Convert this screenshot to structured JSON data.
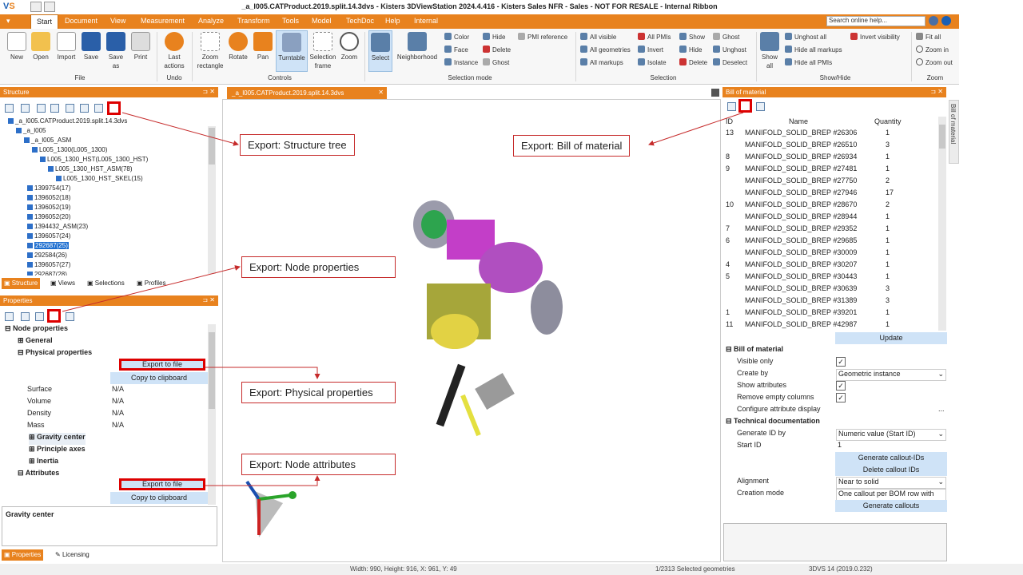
{
  "title": "_a_l005.CATProduct.2019.split.14.3dvs - Kisters 3DViewStation 2024.4.416 - Kisters Sales NFR - Sales - NOT FOR RESALE - Internal Ribbon",
  "menu": [
    "Start",
    "Document",
    "View",
    "Measurement",
    "Analyze",
    "Transform",
    "Tools",
    "Model",
    "TechDoc",
    "Help",
    "Internal"
  ],
  "search_placeholder": "Search online help...",
  "ribbon": {
    "file": [
      "New",
      "Open",
      "Import",
      "Save",
      "Save as",
      "Print"
    ],
    "file_group": "File",
    "undo": "Last actions",
    "undo_group": "Undo",
    "controls": [
      "Zoom rectangle",
      "Rotate",
      "Pan",
      "Turntable",
      "Selection frame",
      "Zoom"
    ],
    "controls_group": "Controls",
    "selmode_big": [
      "Select",
      "Neighborhood"
    ],
    "selmode_small": [
      "Color",
      "Face",
      "Instance",
      "Hide",
      "Delete",
      "Ghost",
      "PMI reference"
    ],
    "selmode_group": "Selection mode",
    "selection_small": [
      "All visible",
      "All geometries",
      "All markups",
      "All PMIs",
      "Invert",
      "Isolate",
      "Show",
      "Hide",
      "Delete",
      "Ghost",
      "Unghost",
      "Deselect"
    ],
    "selection_group": "Selection",
    "showhide_big": "Show all",
    "showhide_small": [
      "Unghost all",
      "Hide all markups",
      "Hide all PMIs",
      "Invert visibility"
    ],
    "showhide_group": "Show/Hide",
    "zoom_small": [
      "Fit all",
      "Zoom in",
      "Zoom out"
    ],
    "zoom_group": "Zoom"
  },
  "structure": {
    "header": "Structure",
    "rows": [
      "_a_l005.CATProduct.2019.split.14.3dvs",
      "_a_l005",
      "_a_l005_ASM",
      "L005_1300(L005_1300)",
      "L005_1300_HST(L005_1300_HST)",
      "L005_1300_HST_ASM(78)",
      "L005_1300_HST_SKEL(15)",
      "1399754(17)",
      "1396052(18)",
      "1396052(19)",
      "1396052(20)",
      "1394432_ASM(23)",
      "1396057(24)",
      "292687(25)",
      "292584(26)",
      "1396057(27)",
      "292687(28)"
    ],
    "tabs": [
      "Structure",
      "Views",
      "Selections",
      "Profiles"
    ]
  },
  "properties": {
    "header": "Properties",
    "node": "Node properties",
    "general": "General",
    "physical": "Physical properties",
    "export": "Export to file",
    "copy": "Copy to clipboard",
    "fields": [
      [
        "Surface",
        "N/A"
      ],
      [
        "Volume",
        "N/A"
      ],
      [
        "Density",
        "N/A"
      ],
      [
        "Mass",
        "N/A"
      ]
    ],
    "sub": [
      "Gravity center",
      "Principle axes",
      "Inertia"
    ],
    "attributes": "Attributes",
    "desc_title": "Gravity center",
    "tabs": [
      "Properties",
      "Licensing"
    ]
  },
  "callouts": {
    "structure": "Export: Structure tree",
    "bom": "Export: Bill of material",
    "node_props": "Export: Node properties",
    "phys": "Export: Physical properties",
    "attrs": "Export: Node attributes"
  },
  "doc_tab": "_a_l005.CATProduct.2019.split.14.3dvs",
  "bom": {
    "header": "Bill of material",
    "cols": [
      "ID",
      "Name",
      "Quantity"
    ],
    "rows": [
      [
        "13",
        "MANIFOLD_SOLID_BREP #26306",
        "1"
      ],
      [
        "",
        "MANIFOLD_SOLID_BREP #26510",
        "3"
      ],
      [
        "8",
        "MANIFOLD_SOLID_BREP #26934",
        "1"
      ],
      [
        "9",
        "MANIFOLD_SOLID_BREP #27481",
        "1"
      ],
      [
        "",
        "MANIFOLD_SOLID_BREP #27750",
        "2"
      ],
      [
        "",
        "MANIFOLD_SOLID_BREP #27946",
        "17"
      ],
      [
        "10",
        "MANIFOLD_SOLID_BREP #28670",
        "2"
      ],
      [
        "",
        "MANIFOLD_SOLID_BREP #28944",
        "1"
      ],
      [
        "7",
        "MANIFOLD_SOLID_BREP #29352",
        "1"
      ],
      [
        "6",
        "MANIFOLD_SOLID_BREP #29685",
        "1"
      ],
      [
        "",
        "MANIFOLD_SOLID_BREP #30009",
        "1"
      ],
      [
        "4",
        "MANIFOLD_SOLID_BREP #30207",
        "1"
      ],
      [
        "5",
        "MANIFOLD_SOLID_BREP #30443",
        "1"
      ],
      [
        "",
        "MANIFOLD_SOLID_BREP #30639",
        "3"
      ],
      [
        "",
        "MANIFOLD_SOLID_BREP #31389",
        "3"
      ],
      [
        "1",
        "MANIFOLD_SOLID_BREP #39201",
        "1"
      ],
      [
        "11",
        "MANIFOLD_SOLID_BREP #42987",
        "1"
      ]
    ],
    "update": "Update",
    "settings_title": "Bill of material",
    "settings": [
      [
        "Visible only",
        "check"
      ],
      [
        "Create by",
        "Geometric instance"
      ],
      [
        "Show attributes",
        "check"
      ],
      [
        "Remove empty columns",
        "check"
      ],
      [
        "Configure attribute display",
        "..."
      ]
    ],
    "tech_title": "Technical documentation",
    "tech": [
      [
        "Generate ID by",
        "Numeric value (Start ID)"
      ],
      [
        "Start ID",
        "1"
      ]
    ],
    "btn_gen": "Generate callout-IDs",
    "btn_del": "Delete callout IDs",
    "tech2": [
      [
        "Alignment",
        "Near to solid"
      ],
      [
        "Creation mode",
        "One callout per BOM row with"
      ]
    ],
    "btn_callouts": "Generate callouts",
    "side_tab": "Bill of material"
  },
  "status": {
    "dims": "Width: 990, Height: 916, X: 961, Y: 49",
    "sel": "1/2313 Selected geometries",
    "ver": "3DVS 14 (2019.0.232)"
  },
  "colors": {
    "accent": "#e8821e",
    "callout_border": "#c62b2b"
  }
}
